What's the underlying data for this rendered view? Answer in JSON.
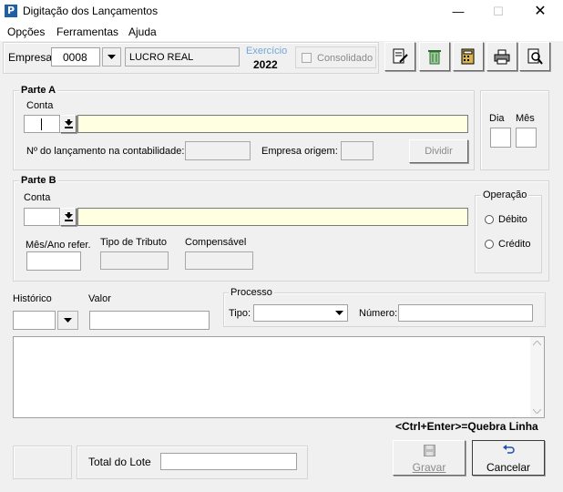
{
  "window": {
    "title": "Digitação dos Lançamentos",
    "app_icon": "P"
  },
  "menu": [
    "Opções",
    "Ferramentas",
    "Ajuda"
  ],
  "toolbar": {
    "empresa_label": "Empresa:",
    "empresa_code": "0008",
    "empresa_name": "LUCRO REAL",
    "exercicio_label": "Exercício",
    "exercicio_value": "2022",
    "consolidado_label": "Consolidado",
    "icon_buttons": [
      "edit-doc-icon",
      "recycle-bin-icon",
      "calculator-icon",
      "printer-icon",
      "print-preview-icon"
    ]
  },
  "parte_a": {
    "title": "Parte A",
    "conta_label": "Conta",
    "conta_value": "",
    "conta_desc": "",
    "n_lanc_label": "Nº do lançamento na contabilidade:",
    "empresa_origem_label": "Empresa origem:",
    "dividir_label": "Dividir"
  },
  "date": {
    "dia_label": "Dia",
    "mes_label": "Mês"
  },
  "parte_b": {
    "title": "Parte B",
    "conta_label": "Conta",
    "mes_ano_label": "Mês/Ano refer.",
    "tipo_tributo_label": "Tipo de Tributo",
    "compensavel_label": "Compensável",
    "operacao_title": "Operação",
    "debito_label": "Débito",
    "credito_label": "Crédito"
  },
  "historico_label": "Histórico",
  "valor_label": "Valor",
  "processo": {
    "title": "Processo",
    "tipo_label": "Tipo:",
    "numero_label": "Número:"
  },
  "hint": "<Ctrl+Enter>=Quebra Linha",
  "total_lote_label": "Total do Lote",
  "gravar_label": "Gravar",
  "cancelar_label": "Cancelar",
  "colors": {
    "field_yellow": "#ffffe1",
    "window_bg": "#f0f0f0",
    "exercicio_blue": "#6fa8dc"
  }
}
